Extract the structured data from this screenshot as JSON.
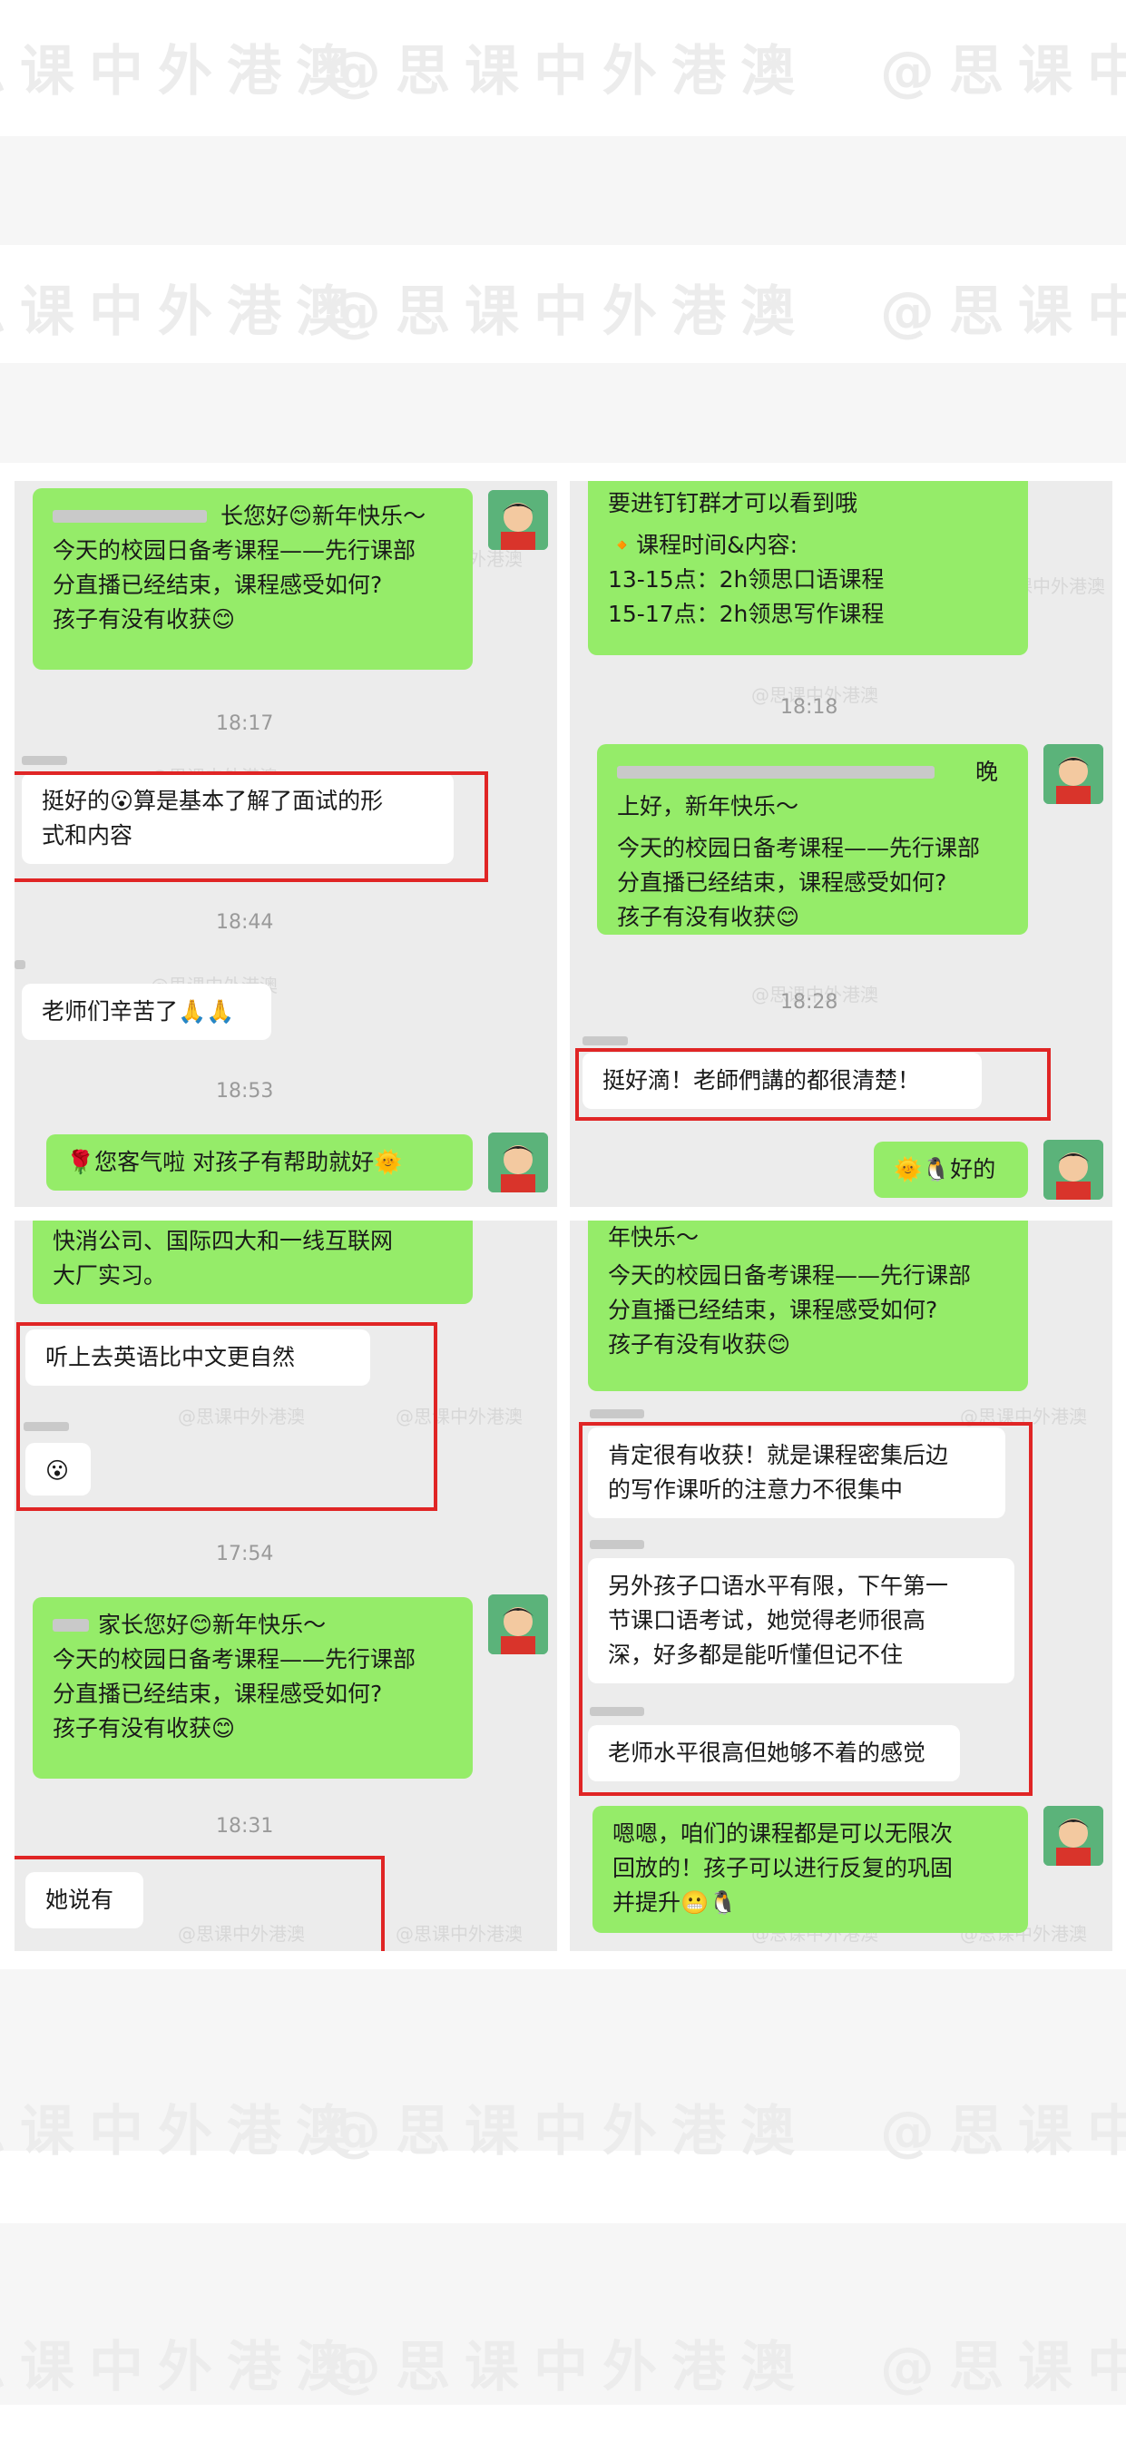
{
  "watermark": "@思课中外港澳",
  "watermark_small": "@思课中外港澳",
  "panel1": {
    "msg1": [
      "长您好😊新年快乐～",
      "今天的校园日备考课程——先行课部",
      "分直播已经结束，课程感受如何?",
      "孩子有没有收获😊"
    ],
    "time1": "18:17",
    "reply1": [
      "挺好的😮算是基本了解了面试的形",
      "式和内容"
    ],
    "time2": "18:44",
    "reply2": "老师们辛苦了🙏🙏",
    "time3": "18:53",
    "msg2": "🌹您客气啦 对孩子有帮助就好🌞"
  },
  "panel2": {
    "msg1": [
      "要进钉钉群才可以看到哦",
      "🔸课程时间&内容:",
      "13-15点：2h领思口语课程",
      "15-17点：2h领思写作课程"
    ],
    "time1": "18:18",
    "msg2": [
      "晚",
      "上好，新年快乐～",
      "今天的校园日备考课程——先行课部",
      "分直播已经结束，课程感受如何?",
      "孩子有没有收获😊"
    ],
    "time2": "18:28",
    "reply1": "挺好滴！老師們講的都很清楚！",
    "msg3": "🌞🐧好的"
  },
  "panel3": {
    "msg1": [
      "快消公司、国际四大和一线互联网",
      "大厂实习。"
    ],
    "reply1": "听上去英语比中文更自然",
    "reply2": "😮",
    "time1": "17:54",
    "msg2": [
      "家长您好😊新年快乐～",
      "今天的校园日备考课程——先行课部",
      "分直播已经结束，课程感受如何?",
      "孩子有没有收获😊"
    ],
    "time2": "18:31",
    "reply3": "她说有"
  },
  "panel4": {
    "msg1": [
      "年快乐～",
      "今天的校园日备考课程——先行课部",
      "分直播已经结束，课程感受如何?",
      "孩子有没有收获😊"
    ],
    "reply1": [
      "肯定很有收获！就是课程密集后边",
      "的写作课听的注意力不很集中"
    ],
    "reply2": [
      "另外孩子口语水平有限，下午第一",
      "节课口语考试，她觉得老师很高",
      "深，好多都是能听懂但记不住"
    ],
    "reply3": "老师水平很高但她够不着的感觉",
    "msg2": [
      "嗯嗯，咱们的课程都是可以无限次",
      "回放的！孩子可以进行反复的巩固",
      "并提升😬🐧"
    ]
  }
}
